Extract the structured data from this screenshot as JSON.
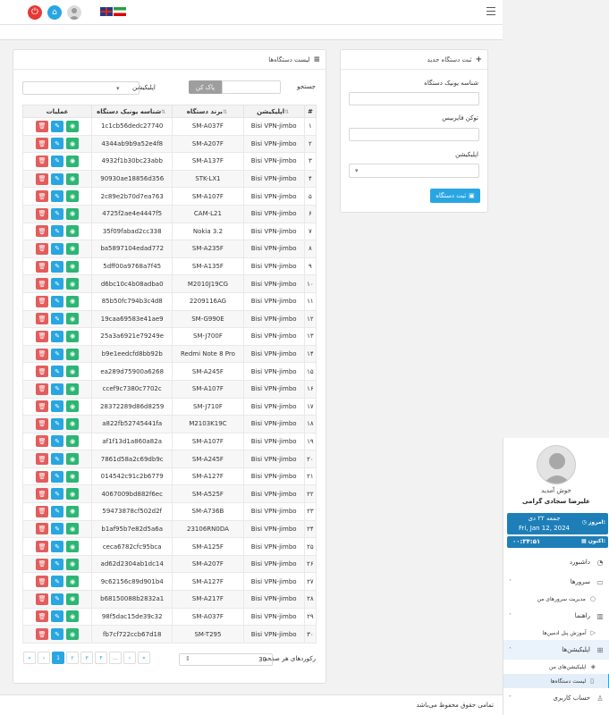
{
  "header": {
    "icons": [
      "power-icon",
      "home-icon",
      "user-avatar",
      "flag-uk-icon",
      "flag-iran-icon",
      "menu-icon"
    ]
  },
  "register": {
    "title": "ثبت دستگاه جدید",
    "uid_label": "شناسه یونیک دستگاه",
    "token_label": "توکن فایربیس",
    "app_label": "اپلیکیشن",
    "submit": "ثبت دستگاه"
  },
  "list": {
    "title": "لیست دستگاه‌ها",
    "search_label": "جستجو",
    "clear_btn": "پاک کن",
    "app_label": "اپلیکیشن",
    "columns": {
      "num": "#",
      "app": "اپلیکیشن",
      "brand": "برند دستگاه",
      "uid": "شناسه یونیک دستگاه",
      "ops": "عملیات"
    },
    "rows": [
      {
        "num": "۱",
        "app": "Bisi VPN-jimbo",
        "brand": "SM-A037F",
        "uid": "1c1cb56dedc27740"
      },
      {
        "num": "۲",
        "app": "Bisi VPN-jimbo",
        "brand": "SM-A207F",
        "uid": "4344ab9b9a52e4f8"
      },
      {
        "num": "۳",
        "app": "Bisi VPN-jimbo",
        "brand": "SM-A137F",
        "uid": "4932f1b30bc23abb"
      },
      {
        "num": "۴",
        "app": "Bisi VPN-jimbo",
        "brand": "STK-LX1",
        "uid": "90930ae18856d356"
      },
      {
        "num": "۵",
        "app": "Bisi VPN-jimbo",
        "brand": "SM-A107F",
        "uid": "2c89e2b70d7ea763"
      },
      {
        "num": "۶",
        "app": "Bisi VPN-jimbo",
        "brand": "CAM-L21",
        "uid": "4725f2ae4e4447f5"
      },
      {
        "num": "۷",
        "app": "Bisi VPN-jimbo",
        "brand": "Nokia 3.2",
        "uid": "35f09fabad2cc338"
      },
      {
        "num": "۸",
        "app": "Bisi VPN-jimbo",
        "brand": "SM-A235F",
        "uid": "ba5897104edad772"
      },
      {
        "num": "۹",
        "app": "Bisi VPN-jimbo",
        "brand": "SM-A135F",
        "uid": "5dff00a9768a7f45"
      },
      {
        "num": "۱۰",
        "app": "Bisi VPN-jimbo",
        "brand": "M2010J19CG",
        "uid": "d6bc10c4b08adba0"
      },
      {
        "num": "۱۱",
        "app": "Bisi VPN-jimbo",
        "brand": "2209116AG",
        "uid": "85b50fc794b3c4d8"
      },
      {
        "num": "۱۲",
        "app": "Bisi VPN-jimbo",
        "brand": "SM-G990E",
        "uid": "19caa69583e41ae9"
      },
      {
        "num": "۱۳",
        "app": "Bisi VPN-jimbo",
        "brand": "SM-J700F",
        "uid": "25a3a6921e79249e"
      },
      {
        "num": "۱۴",
        "app": "Bisi VPN-jimbo",
        "brand": "Redmi Note 8 Pro",
        "uid": "b9e1eedcfd8bb92b"
      },
      {
        "num": "۱۵",
        "app": "Bisi VPN-jimbo",
        "brand": "SM-A245F",
        "uid": "ea289d75900a6268"
      },
      {
        "num": "۱۶",
        "app": "Bisi VPN-jimbo",
        "brand": "SM-A107F",
        "uid": "ccef9c7380c7702c"
      },
      {
        "num": "۱۷",
        "app": "Bisi VPN-jimbo",
        "brand": "SM-J710F",
        "uid": "28372289d86d8259"
      },
      {
        "num": "۱۸",
        "app": "Bisi VPN-jimbo",
        "brand": "M2103K19C",
        "uid": "a822fb52745441fa"
      },
      {
        "num": "۱۹",
        "app": "Bisi VPN-jimbo",
        "brand": "SM-A107F",
        "uid": "af1f13d1a860a82a"
      },
      {
        "num": "۲۰",
        "app": "Bisi VPN-jimbo",
        "brand": "SM-A245F",
        "uid": "7861d58a2c69db9c"
      },
      {
        "num": "۲۱",
        "app": "Bisi VPN-jimbo",
        "brand": "SM-A127F",
        "uid": "014542c91c2b6779"
      },
      {
        "num": "۲۲",
        "app": "Bisi VPN-jimbo",
        "brand": "SM-A525F",
        "uid": "4067009bd882f6ec"
      },
      {
        "num": "۲۳",
        "app": "Bisi VPN-jimbo",
        "brand": "SM-A736B",
        "uid": "59473878cf502d2f"
      },
      {
        "num": "۲۴",
        "app": "Bisi VPN-jimbo",
        "brand": "23106RN0DA",
        "uid": "b1af95b7e82d5a6a"
      },
      {
        "num": "۲۵",
        "app": "Bisi VPN-jimbo",
        "brand": "SM-A125F",
        "uid": "ceca6782cfc95bca"
      },
      {
        "num": "۲۶",
        "app": "Bisi VPN-jimbo",
        "brand": "SM-A207F",
        "uid": "ad62d2304ab1dc14"
      },
      {
        "num": "۲۷",
        "app": "Bisi VPN-jimbo",
        "brand": "SM-A127F",
        "uid": "9c62156c89d901b4"
      },
      {
        "num": "۲۸",
        "app": "Bisi VPN-jimbo",
        "brand": "SM-A217F",
        "uid": "b68150088b2832a1"
      },
      {
        "num": "۲۹",
        "app": "Bisi VPN-jimbo",
        "brand": "SM-A037F",
        "uid": "98f5dac15de39c32"
      },
      {
        "num": "۳۰",
        "app": "Bisi VPN-jimbo",
        "brand": "SM-T295",
        "uid": "fb7cf722ccb67d18"
      }
    ],
    "page_size_label": "رکوردهای هر صفحه",
    "page_size": "30",
    "pages": [
      "»",
      "›",
      "1",
      "۲",
      "۳",
      "۴",
      "...",
      "‹",
      "«"
    ]
  },
  "footer": {
    "text": "تمامی حقوق محفوظ می‌باشد"
  },
  "sidebar": {
    "welcome": "خوش آمدید",
    "user_name": "علیرضا سجادی گرامی",
    "today_label": "امروز:",
    "date_fa": "جمعه ۲۲ دی",
    "date_en": "Fri, Jan 12, 2024",
    "now_label": "اکنون:",
    "time": "۰۰:۳۴:۵۱",
    "menu": {
      "dashboard": "داشبورد",
      "servers": "سرورها",
      "my_servers": "مدیریت سرورهای من",
      "guide": "راهنما",
      "admin_training": "آموزش پنل ادمین‌ها",
      "apps": "اپلیکیشن‌ها",
      "my_apps": "اپلیکیشن‌های من",
      "device_list": "لیست دستگاه‌ها",
      "account": "حساب کاربری"
    }
  },
  "colors": {
    "primary": "#29a6e2",
    "danger": "#e35d5d",
    "success": "#2bb673",
    "dark_blue": "#1e7fb8"
  }
}
